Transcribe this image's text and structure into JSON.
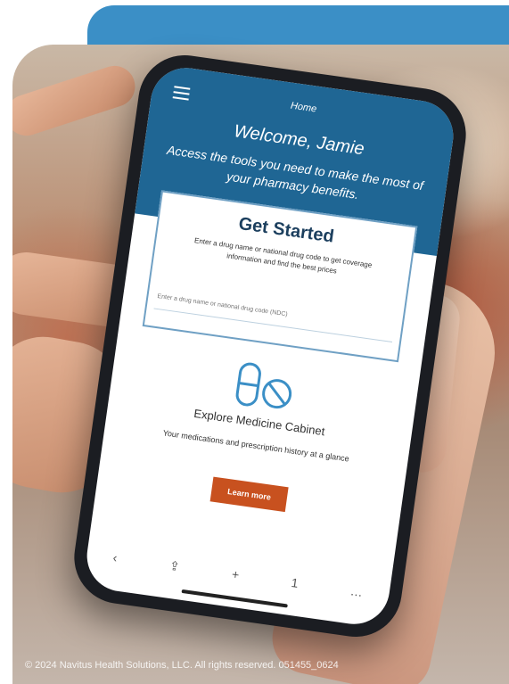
{
  "app": {
    "nav_title": "Home",
    "welcome": "Welcome, Jamie",
    "subtitle": "Access the tools you need to make the most of your pharmacy benefits."
  },
  "get_started": {
    "title": "Get Started",
    "description": "Enter a drug name or national drug code to get coverage information and find the best prices",
    "input_placeholder": "Enter a drug name or national drug code (NDC)"
  },
  "medicine_cabinet": {
    "title": "Explore Medicine Cabinet",
    "description": "Your medications and prescription history at a glance",
    "button_label": "Learn more"
  },
  "browser_bar": {
    "back": "‹",
    "share": "⇪",
    "add": "+",
    "tabs": "1",
    "more": "…"
  },
  "footer": {
    "copyright": "© 2024 Navitus Health Solutions, LLC. All rights reserved. 051455_0624"
  },
  "colors": {
    "band": "#3b8fc6",
    "header": "#1f6694",
    "button": "#c8511f"
  }
}
